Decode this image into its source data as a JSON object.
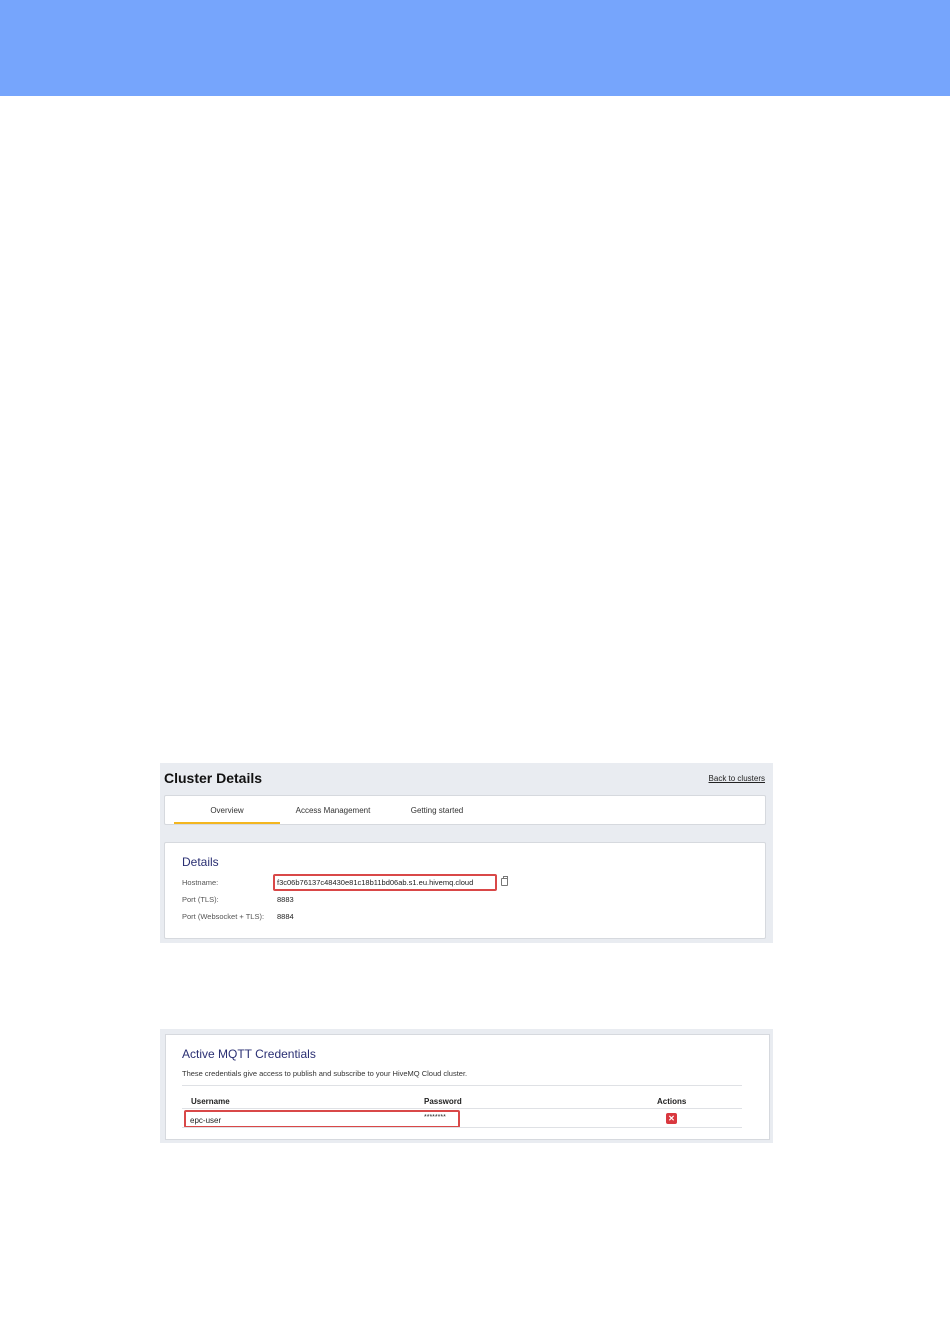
{
  "cluster": {
    "title": "Cluster Details",
    "back_link": "Back to clusters",
    "tabs": [
      "Overview",
      "Access Management",
      "Getting started"
    ],
    "details": {
      "heading": "Details",
      "hostname_label": "Hostname:",
      "hostname_value": "f3c06b76137c48430e81c18b11bd06ab.s1.eu.hivemq.cloud",
      "port_tls_label": "Port (TLS):",
      "port_tls_value": "8883",
      "port_ws_label": "Port (Websocket + TLS):",
      "port_ws_value": "8884"
    }
  },
  "credentials": {
    "heading": "Active MQTT Credentials",
    "description": "These credentials give access to publish and subscribe to your HiveMQ Cloud cluster.",
    "columns": [
      "Username",
      "Password",
      "Actions"
    ],
    "rows": [
      {
        "username": "epc-user",
        "password": "********",
        "action": "delete"
      }
    ]
  },
  "colors": {
    "banner": "#76a5fc",
    "tab_active_underline": "#f3b61f",
    "highlight_box": "#d94848",
    "delete_button": "#d9383f",
    "heading": "#2a2f73"
  }
}
